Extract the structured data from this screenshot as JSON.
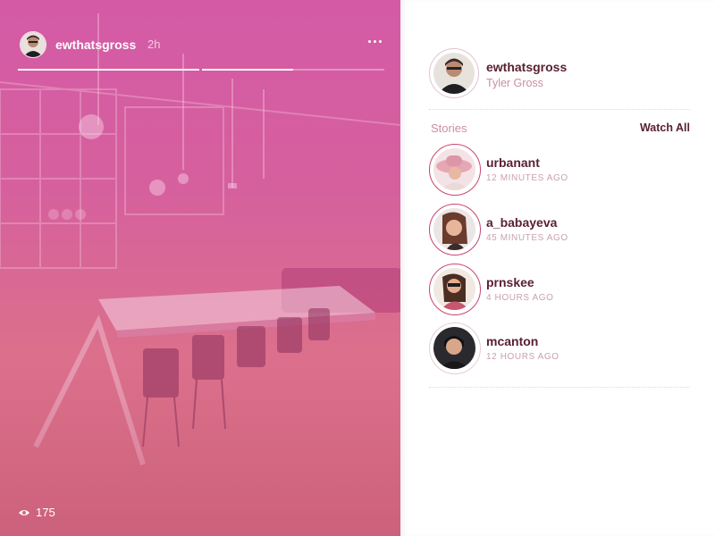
{
  "story": {
    "username": "ewthatsgross",
    "time": "2h",
    "views": "175",
    "progress_segments": 2,
    "active_segment": 2,
    "active_segment_progress": 0.5,
    "icons": {
      "more": "more-icon",
      "views": "eye-icon"
    }
  },
  "profile": {
    "username": "ewthatsgross",
    "full_name": "Tyler Gross"
  },
  "stories": {
    "heading": "Stories",
    "watch_all_label": "Watch All",
    "items": [
      {
        "username": "urbanant",
        "time": "12 MINUTES AGO",
        "seen": false
      },
      {
        "username": "a_babayeva",
        "time": "45 MINUTES AGO",
        "seen": false
      },
      {
        "username": "prnskee",
        "time": "4 HOURS AGO",
        "seen": false
      },
      {
        "username": "mcanton",
        "time": "12 HOURS AGO",
        "seen": true
      }
    ]
  },
  "colors": {
    "accent": "#c9456f",
    "name_text": "#5a2030",
    "muted_text": "#c98fa3",
    "story_tint_top": "#d45aa6",
    "story_tint_bottom": "#d86f86"
  }
}
